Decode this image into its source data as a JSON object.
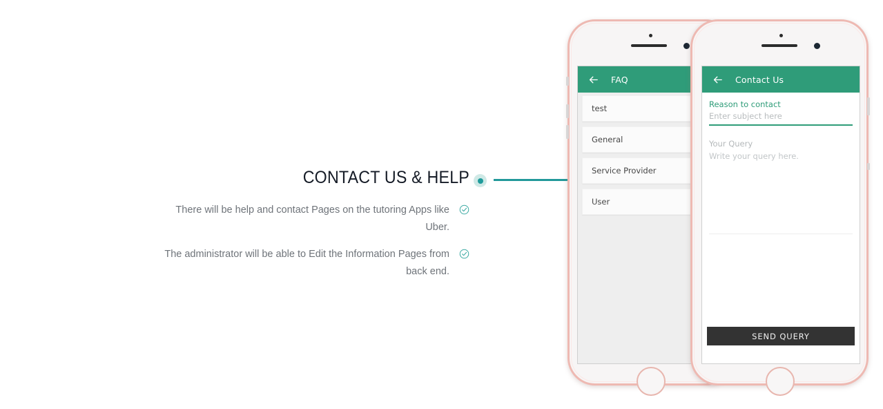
{
  "feature": {
    "title": "CONTACT US & HELP",
    "bullets": [
      {
        "text": "There will be help and contact Pages on the tutoring Apps like Uber.",
        "icon": "check-circle-icon"
      },
      {
        "text": "The administrator will be able to Edit the Information Pages from back end.",
        "icon": "check-circle-icon"
      }
    ]
  },
  "colors": {
    "accent_teal": "#21999a",
    "app_green": "#2f9c79",
    "bezel_rose": "#eeb9b2",
    "button_dark": "#333333",
    "body_text": "#6e7379",
    "title_text": "#151b26"
  },
  "phones": {
    "left": {
      "appbar": {
        "title": "FAQ",
        "back_icon": "back-arrow-icon"
      },
      "list_items": [
        {
          "label": "test"
        },
        {
          "label": "General"
        },
        {
          "label": "Service Provider"
        },
        {
          "label": "User"
        }
      ]
    },
    "right": {
      "appbar": {
        "title": "Contact Us",
        "back_icon": "back-arrow-icon"
      },
      "form": {
        "subject_label": "Reason to contact",
        "subject_value": "",
        "subject_placeholder": "Enter subject here",
        "query_label": "Your Query",
        "query_value": "",
        "query_placeholder": "Write your query here.",
        "submit_label": "SEND QUERY"
      }
    }
  }
}
